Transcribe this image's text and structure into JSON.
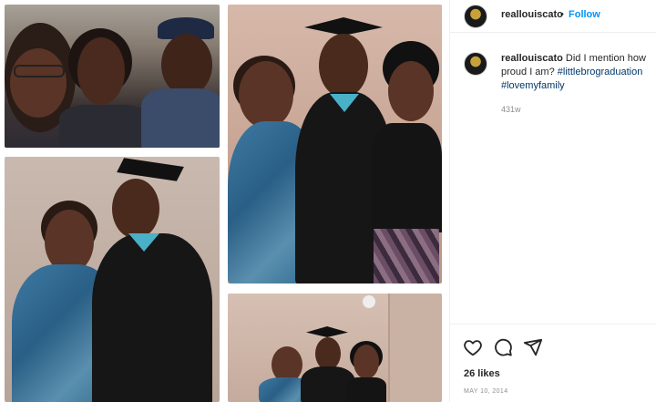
{
  "post": {
    "username": "reallouiscato",
    "follow_label": "Follow",
    "separator": "•",
    "caption_text": "Did I mention how proud I am?",
    "hashtags": [
      "#littlebrograduation",
      "#lovemyfamily"
    ],
    "caption_age": "431w",
    "likes_label": "26 likes",
    "date_label": "MAY 10, 2014"
  },
  "icons": {
    "avatar": "profile-avatar",
    "like": "heart-icon",
    "comment": "comment-bubble-icon",
    "share": "paper-plane-icon"
  },
  "colors": {
    "follow": "#0095f6",
    "hashtag": "#00376b",
    "secondary_text": "#8e8e8e",
    "primary_text": "#262626"
  },
  "collage": {
    "photos": [
      "group-selfie-photo",
      "graduate-with-mother-photo",
      "graduate-family-portrait-photo",
      "graduate-family-room-photo"
    ]
  }
}
